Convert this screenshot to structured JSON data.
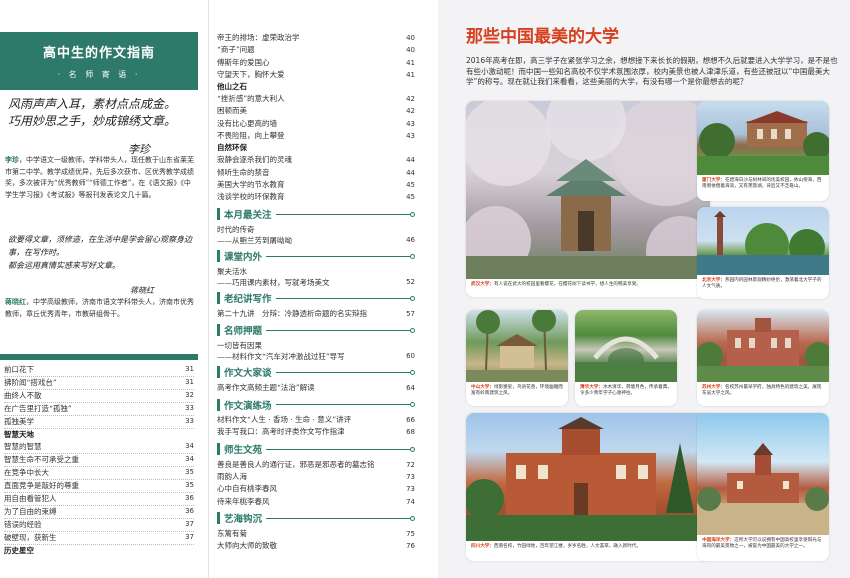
{
  "left_page": {
    "header": {
      "title": "高中生的作文指南",
      "subtitle": "· 名 师 寄 语 ·"
    },
    "calligraphy1": {
      "line1": "风雨声声入耳，素材点点成金。",
      "line2": "巧用妙思之手，妙成锦绣文章。",
      "signature": "李珍"
    },
    "bio1": {
      "name": "李珍",
      "text": "，中学语文一级教师，学科带头人，现任教于山东省莱芜市第二中学。教学成绩优异，先后多次获市、区优秀教学成绩奖，多次被评为“优秀教师”“师德工作者”，在《语文报》《中学生学习报》《考试报》等报刊发表论文几十篇。"
    },
    "calligraphy2": {
      "line1": "欲要得文章，须修造，在生活中是学会留心观察身边事，在写作时。",
      "line2": "都会运用真情实感来写好文章。",
      "signature": "蒋晓红"
    },
    "bio2": {
      "name": "蒋晓红",
      "text": "，中学高级教师，济南市语文学科带头人，济南市优秀教师，章丘优秀青年，市教研组骨干。"
    },
    "toc_col1": [
      {
        "title": "前口花下",
        "page": "31"
      },
      {
        "title": "拂阶闻“搭戏台”",
        "page": "31"
      },
      {
        "title": "曲终人不散",
        "page": "32"
      },
      {
        "title": "在广告里打造“孤独”",
        "page": "33"
      },
      {
        "title": "孤独美学",
        "page": "33"
      },
      {
        "title": "智慧天地",
        "page": "",
        "sub": true
      },
      {
        "title": "智慧的智慧",
        "page": "34"
      },
      {
        "title": "智慧生命不可承受之重",
        "page": "34"
      },
      {
        "title": "在竞争中长大",
        "page": "35"
      },
      {
        "title": "直面竞争是敲好的尊重",
        "page": "35"
      },
      {
        "title": "用自由看管犯人",
        "page": "36"
      },
      {
        "title": "为了自由的束缚",
        "page": "36"
      },
      {
        "title": "错误的经验",
        "page": "37"
      },
      {
        "title": "破壁现，获新生",
        "page": "37"
      },
      {
        "title": "历史星空",
        "page": "",
        "sub": true
      }
    ],
    "toc_col2": [
      {
        "kind": "entry",
        "title": "帝王的排场：虚荣政治学",
        "page": "40"
      },
      {
        "kind": "entry",
        "title": "“商子”问题",
        "page": "40"
      },
      {
        "kind": "entry",
        "title": "傅斯年的爱国心",
        "page": "41"
      },
      {
        "kind": "entry",
        "title": "守望天下，胸怀大爱",
        "page": "41"
      },
      {
        "kind": "sub",
        "title": "他山之石"
      },
      {
        "kind": "entry",
        "title": "“挫折感”的意大利人",
        "page": "42"
      },
      {
        "kind": "entry",
        "title": "困顿而美",
        "page": "42"
      },
      {
        "kind": "entry",
        "title": "没有比心更高的墙",
        "page": "43"
      },
      {
        "kind": "entry",
        "title": "不畏险阻，向上攀登",
        "page": "43"
      },
      {
        "kind": "sub",
        "title": "自然环保"
      },
      {
        "kind": "entry",
        "title": "寂静会逐杀我们的灵魂",
        "page": "44"
      },
      {
        "kind": "entry",
        "title": "倾听生命的禁音",
        "page": "44"
      },
      {
        "kind": "entry",
        "title": "美国大学的节水教育",
        "page": "45"
      },
      {
        "kind": "entry",
        "title": "浅谈学校的环保教育",
        "page": "45"
      },
      {
        "kind": "section",
        "title": "本月最关注"
      },
      {
        "kind": "entry2",
        "title": "时代的传奇",
        "page": ""
      },
      {
        "kind": "entry2",
        "title": "——从鲍兰芳到屠呦呦",
        "page": "46"
      },
      {
        "kind": "section",
        "title": "课堂内外"
      },
      {
        "kind": "entry2",
        "title": "聚夫活水",
        "page": ""
      },
      {
        "kind": "entry2",
        "title": "——巧用课内素材，写就考场美文",
        "page": "52"
      },
      {
        "kind": "section",
        "title": "老纪讲写作"
      },
      {
        "kind": "entry",
        "title": "第二十九讲　分辩：冷静透析命题的名实辩指",
        "page": "57"
      },
      {
        "kind": "section",
        "title": "名师押题"
      },
      {
        "kind": "entry2",
        "title": "一切皆有因果",
        "page": ""
      },
      {
        "kind": "entry2",
        "title": "——材料作文“汽车对冲激战过狂”导写",
        "page": "60"
      },
      {
        "kind": "section",
        "title": "作文大家谈"
      },
      {
        "kind": "entry",
        "title": "高考作文高频主题“法治”解读",
        "page": "64"
      },
      {
        "kind": "section",
        "title": "作文演练场"
      },
      {
        "kind": "entry",
        "title": "材料作文“人生 · 香场 · 生命 · 意义”讲评",
        "page": "66"
      },
      {
        "kind": "entry",
        "title": "我手写我口：高考时评类作文写作指津",
        "page": "68"
      },
      {
        "kind": "section",
        "title": "师生文苑"
      },
      {
        "kind": "entry",
        "title": "善良是善良人的通行证，邪恶是邪恶者的墓志铭",
        "page": "72"
      },
      {
        "kind": "entry",
        "title": "雨韵人海",
        "page": "73"
      },
      {
        "kind": "entry",
        "title": "心中自有桃李春风",
        "page": "73"
      },
      {
        "kind": "entry",
        "title": "待来年桃李春风",
        "page": "74"
      },
      {
        "kind": "section",
        "title": "艺海钩沉"
      },
      {
        "kind": "entry",
        "title": "东篱有菊",
        "page": "75"
      },
      {
        "kind": "entry",
        "title": "大师向大师的致敬",
        "page": "76"
      }
    ]
  },
  "right_page": {
    "title": "那些中国最美的大学",
    "intro": "2016年高考在即，高三学子在紧张学习之余，想想接下来长长的假期，想想不久后就要进入大学学习，是不是也有些小激动呢！而中国一些知名高校不仅学术氛围浓厚，校内美景也被人津津乐道，有些还被冠以“中国最美大学”的称号。现在就让我们来看看，这些美丽的大学，有没有哪一个是你最想去的呢？",
    "cards": [
      {
        "label": "武汉大学：",
        "caption": "有人说在武大的校园里看樱花，在樱花树下读书学，想人生的畅美享受。"
      },
      {
        "label": "厦门大学：",
        "caption": "在碧海白沙与树林间的优美校园，依山傍海，西南侧依偎着海滨，又有芙蓉湖，背后又不乏靠山。"
      },
      {
        "label": "北京大学：",
        "caption": "燕园内的园林景观精妙绝伦，激荡着北大学子的人文气质。"
      },
      {
        "label": "中山大学：",
        "caption": "绿影婆娑，鸟语花香，环境幽雅而富有岭南建筑之风。"
      },
      {
        "label": "清华大学：",
        "caption": "水木清华，荷塘月色，传承着典，令多少青年学子心驰神往。"
      },
      {
        "label": "苏州大学：",
        "caption": "名校苏州最早学府，独具特色的建筑之美，展现东吴大学之风。"
      },
      {
        "label": "四川大学：",
        "caption": "西南名校，竹园绿地，百年望江楼，岁岁名胜，人文荟萃，融入新时代。"
      },
      {
        "label": "中国海洋大学：",
        "caption": "这所大学可以说拥有中国高校里享受阳光与海风的最美景致之一，被誉为中国最美的大学之一。"
      }
    ]
  }
}
